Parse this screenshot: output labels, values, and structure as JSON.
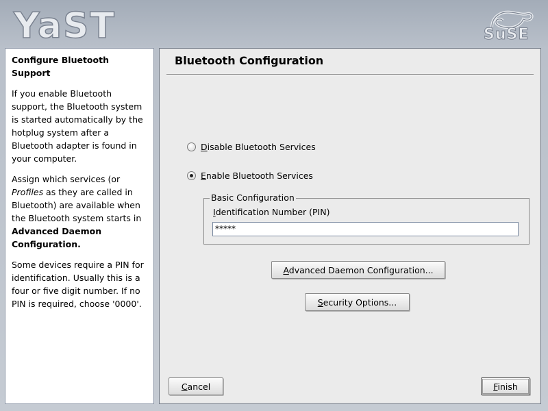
{
  "header": {
    "logo_text": "YaST",
    "vendor_logo_text": "SuSE"
  },
  "help": {
    "title": "Configure Bluetooth Support",
    "para1": "If you enable Bluetooth support, the Bluetooth system is started automatically by the hotplug system after a Bluetooth adapter is found in your computer.",
    "para2_a": "Assign which services (or ",
    "para2_em": "Profiles",
    "para2_b": " as they are called in Bluetooth) are available when the Bluetooth system starts in ",
    "para2_strong": "Advanced Daemon Configuration.",
    "para3": "Some devices require a PIN for identification. Usually this is a four or five digit number. If no PIN is required, choose '0000'."
  },
  "main": {
    "title": "Bluetooth Configuration",
    "disable_radio": {
      "mnemonic": "D",
      "rest": "isable Bluetooth Services",
      "checked": false
    },
    "enable_radio": {
      "mnemonic": "E",
      "rest": "nable Bluetooth Services",
      "checked": true
    },
    "group": {
      "legend": "Basic Configuration",
      "pin_label_mnemonic": "I",
      "pin_label_rest": "dentification Number (PIN)",
      "pin_value": "*****"
    },
    "advanced_button": {
      "mnemonic": "A",
      "rest": "dvanced Daemon Configuration..."
    },
    "security_button": {
      "mnemonic": "S",
      "rest": "ecurity Options..."
    },
    "cancel_button": {
      "mnemonic": "C",
      "rest": "ancel"
    },
    "finish_button": {
      "mnemonic": "F",
      "rest": "inish"
    }
  }
}
